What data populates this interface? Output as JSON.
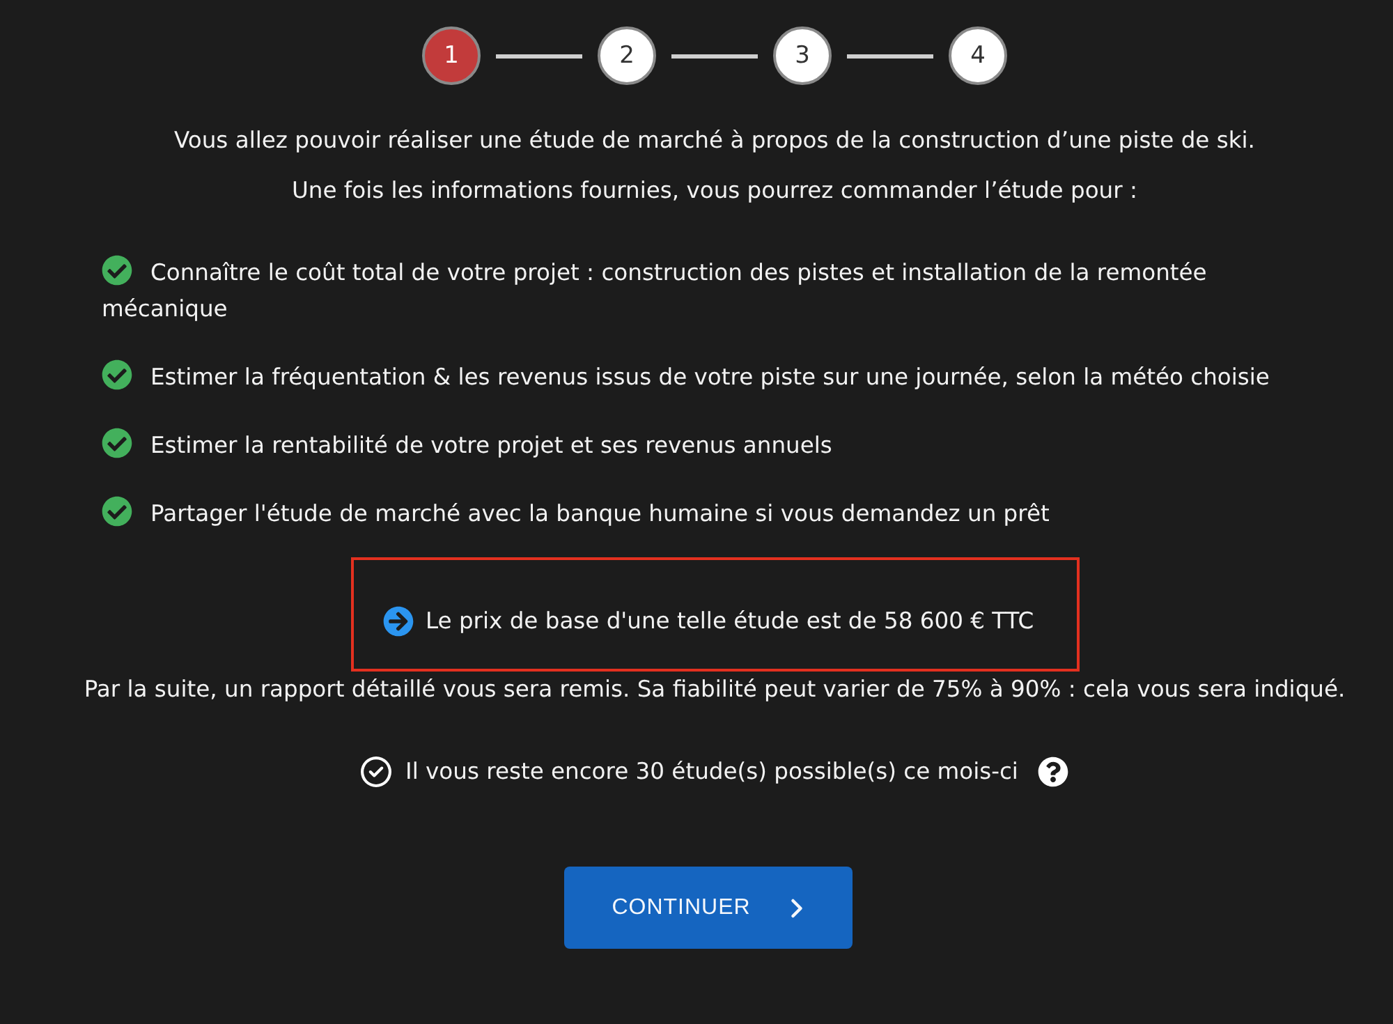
{
  "stepper": {
    "steps": [
      {
        "label": "1",
        "selected": true
      },
      {
        "label": "2",
        "selected": false
      },
      {
        "label": "3",
        "selected": false
      },
      {
        "label": "4",
        "selected": false
      }
    ]
  },
  "intro": [
    "Vous allez pouvoir réaliser une étude de marché à propos de la construction d’une piste de ski.",
    "Une fois les informations fournies, vous pourrez commander l’étude pour :"
  ],
  "benefits": [
    {
      "text": "Connaître le coût total de votre projet : construction des pistes et installation de la remontée mécanique",
      "checked": true
    },
    {
      "text": "Estimer la fréquentation & les revenus issus de votre piste sur une journée, selon la météo choisie",
      "checked": true
    },
    {
      "text": "Estimer la rentabilité de votre projet et ses revenus annuels",
      "checked": true
    },
    {
      "text": "Partager l'étude de marché avec la banque humaine si vous demandez un prêt",
      "checked": true
    }
  ],
  "price_notice": {
    "text": "Le prix de base d'une telle étude est de 58 600 € TTC",
    "highlighted": true
  },
  "report_note": "Par la suite, un rapport détaillé vous sera remis. Sa fiabilité peut varier de 75% à 90% : cela vous sera indiqué.",
  "quota": {
    "text": "Il vous reste encore 30 étude(s) possible(s) ce mois-ci"
  },
  "continue_button": {
    "label": "CONTINUER"
  }
}
